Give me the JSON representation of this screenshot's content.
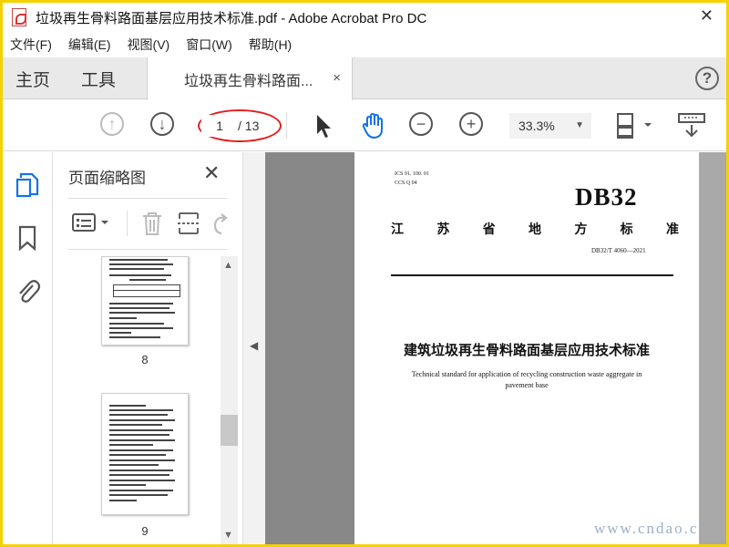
{
  "window": {
    "title": "垃圾再生骨料路面基层应用技术标准.pdf - Adobe Acrobat Pro DC",
    "close_glyph": "✕"
  },
  "menu": [
    {
      "label": "文件(F)"
    },
    {
      "label": "编辑(E)"
    },
    {
      "label": "视图(V)"
    },
    {
      "label": "窗口(W)"
    },
    {
      "label": "帮助(H)"
    }
  ],
  "tabs": {
    "home": "主页",
    "tools": "工具",
    "doc": "垃圾再生骨料路面...",
    "doc_close": "×",
    "help": "?"
  },
  "toolbar": {
    "current_page": "1",
    "total_pages": "/ 13",
    "zoom": "33.3%",
    "zoom_caret": "▼",
    "highlight_color": "#e02020"
  },
  "thumbnails_panel": {
    "title": "页面缩略图",
    "close": "✕",
    "pages": [
      {
        "label": "8"
      },
      {
        "label": "9"
      }
    ],
    "scroll_up": "▲",
    "scroll_down": "▼"
  },
  "collapse_arrow": "◀",
  "document": {
    "ics_line1": "ICS   91. 100. 01",
    "ics_line2": "CCS   Q 04",
    "db_mark": "DB32",
    "category_chars": [
      "江",
      "苏",
      "省",
      "地",
      "方",
      "标",
      "准"
    ],
    "std_code": "DB32/T  4060—2021",
    "title_cn": "建筑垃圾再生骨料路面基层应用技术标准",
    "title_en": "Technical standard for application of recycling construction waste aggregate in pavement base"
  },
  "watermark": "www.cndao.c",
  "colors": {
    "frame": "#f4d100",
    "accent_blue": "#1473e6",
    "doc_bg": "#888888"
  }
}
